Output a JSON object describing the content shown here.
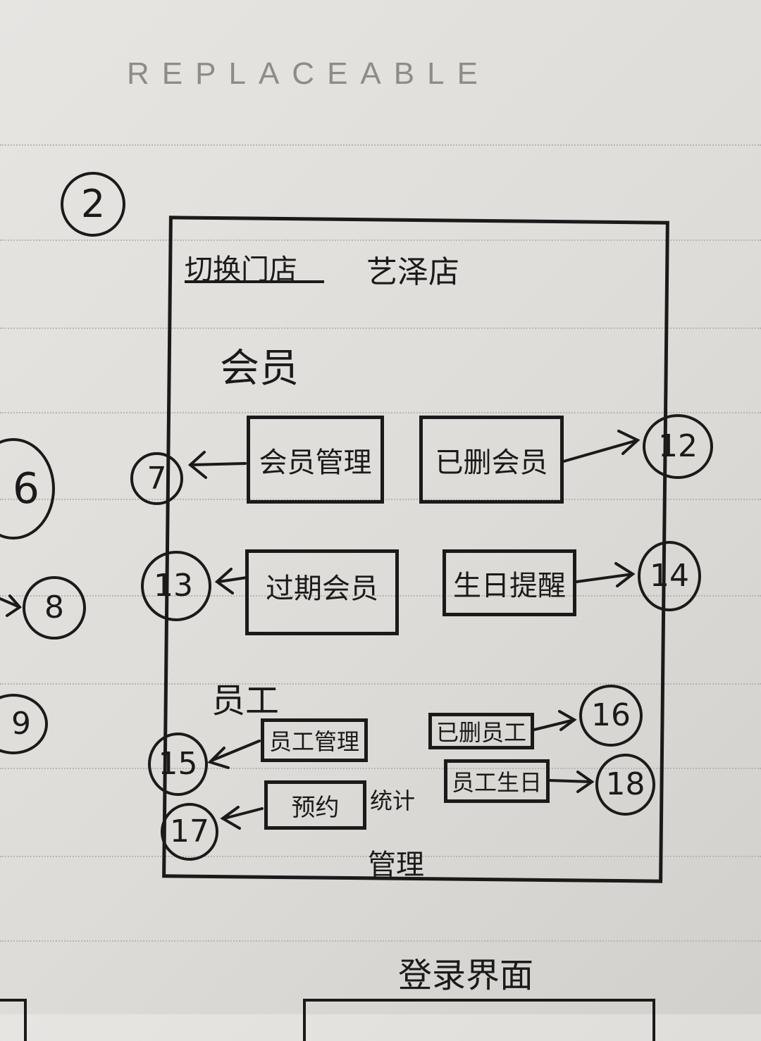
{
  "header": {
    "text": "REPLACEABLE"
  },
  "page_marker": "2",
  "screen": {
    "switch_store_label": "切换门店",
    "store_name": "艺泽店",
    "member_section_title": "会员",
    "member_buttons": [
      "会员管理",
      "已删会员",
      "过期会员",
      "生日提醒"
    ],
    "staff_section_title": "员工",
    "staff_buttons": [
      "员工管理",
      "已删员工",
      "员工生日",
      "预约"
    ],
    "stats_label": "统计",
    "management_label": "管理"
  },
  "link_targets": [
    "6",
    "7",
    "8",
    "9",
    "12",
    "13",
    "14",
    "15",
    "16",
    "17",
    "18"
  ],
  "footer_title": "登录界面"
}
